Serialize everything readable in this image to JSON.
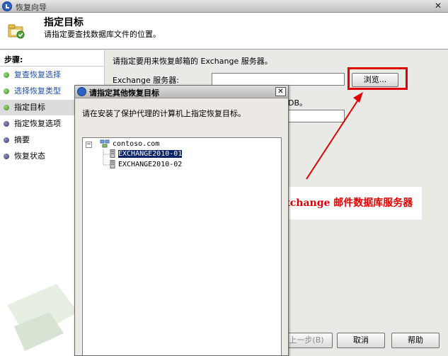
{
  "window": {
    "title": "恢复向导",
    "close_glyph": "✕"
  },
  "header": {
    "title": "指定目标",
    "subtitle": "请指定要查找数据库文件的位置。",
    "icon": "folder-wizard-icon"
  },
  "sidebar": {
    "steps_label": "步骤:",
    "items": [
      {
        "label": "复查恢复选择",
        "state": "done"
      },
      {
        "label": "选择恢复类型",
        "state": "done"
      },
      {
        "label": "指定目标",
        "state": "current"
      },
      {
        "label": "指定恢复选项",
        "state": "pending"
      },
      {
        "label": "摘要",
        "state": "pending"
      },
      {
        "label": "恢复状态",
        "state": "pending"
      }
    ]
  },
  "main": {
    "prompt": "请指定要用来恢复邮箱的 Exchange 服务器。",
    "server_label": "Exchange 服务器:",
    "server_value": "",
    "db_hint": "DB。",
    "browse_label": "浏览..."
  },
  "footer": {
    "prev_label": "上一步(B)",
    "cancel_label": "取消",
    "help_label": "帮助"
  },
  "annotation": {
    "text": "选择Exchange 邮件数据库服务器",
    "color": "#e00000"
  },
  "dialog": {
    "title": "请指定其他恢复目标",
    "close_glyph": "✕",
    "description": "请在安装了保护代理的计算机上指定恢复目标。",
    "tree": {
      "root": {
        "label": "contoso.com",
        "expander": "−"
      },
      "children": [
        {
          "label": "EXCHANGE2010-01",
          "selected": true
        },
        {
          "label": "EXCHANGE2010-02",
          "selected": false
        }
      ]
    }
  }
}
